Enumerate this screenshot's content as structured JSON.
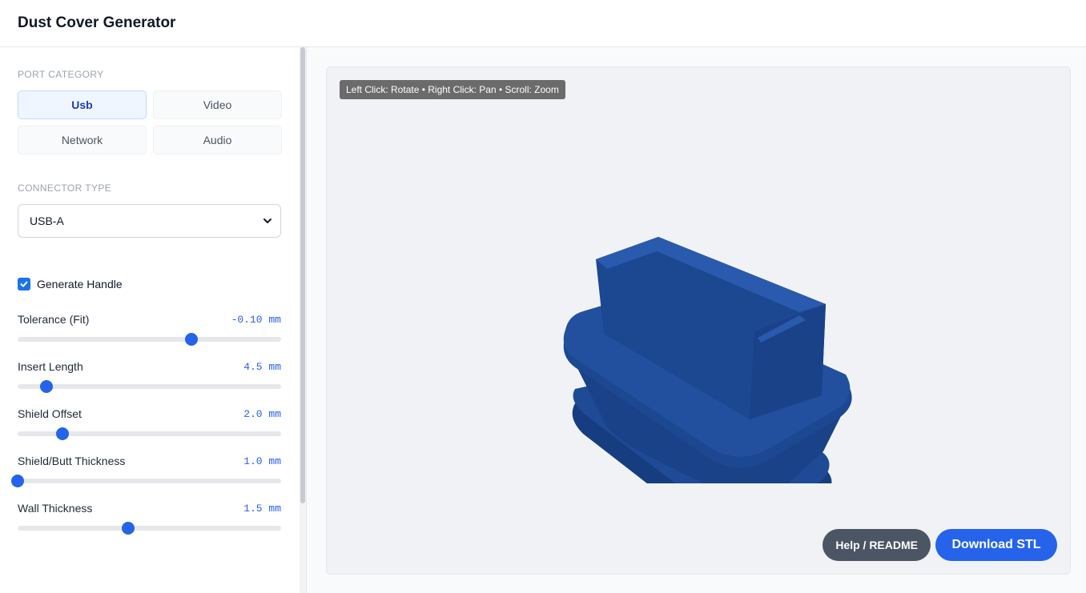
{
  "app": {
    "title": "Dust Cover Generator"
  },
  "port_category": {
    "label": "Port Category",
    "options": [
      "Usb",
      "Video",
      "Network",
      "Audio"
    ],
    "selected": "Usb"
  },
  "connector_type": {
    "label": "Connector Type",
    "value": "USB-A"
  },
  "generate_handle": {
    "label": "Generate Handle",
    "checked": true
  },
  "sliders": [
    {
      "label": "Tolerance (Fit)",
      "value": "-0.10 mm",
      "level": 0.66
    },
    {
      "label": "Insert Length",
      "value": "4.5 mm",
      "level": 0.11
    },
    {
      "label": "Shield Offset",
      "value": "2.0 mm",
      "level": 0.17
    },
    {
      "label": "Shield/Butt Thickness",
      "value": "1.0 mm",
      "level": 0.0
    },
    {
      "label": "Wall Thickness",
      "value": "1.5 mm",
      "level": 0.42
    }
  ],
  "viewer": {
    "hint": "Left Click: Rotate • Right Click: Pan • Scroll: Zoom",
    "model_color": "#1e4a96"
  },
  "actions": {
    "help_label": "Help / README",
    "download_label": "Download STL"
  },
  "colors": {
    "accent": "#2563eb",
    "help_button": "#4b5563"
  }
}
